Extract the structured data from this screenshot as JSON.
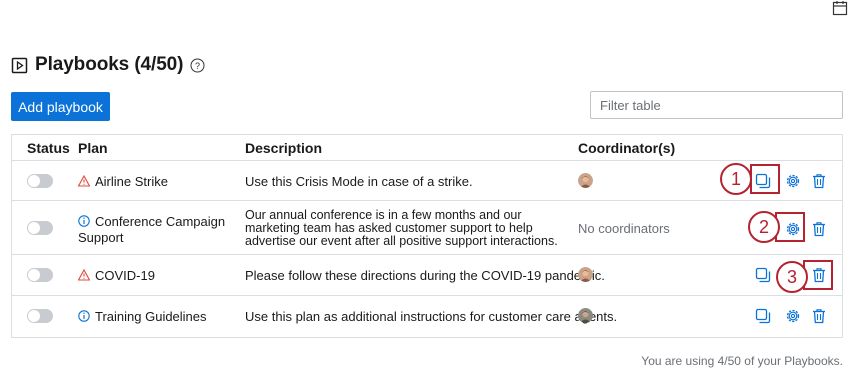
{
  "page": {
    "title": "Playbooks (4/50)",
    "add_button": "Add playbook",
    "filter_placeholder": "Filter table",
    "footer": "You are using 4/50 of your Playbooks."
  },
  "table": {
    "columns": [
      "Status",
      "Plan",
      "Description",
      "Coordinator(s)"
    ],
    "rows": [
      {
        "plan": "Airline Strike",
        "plan_icon": "warning-icon",
        "description": "Use this Crisis Mode in case of a strike.",
        "coordinator": "avatar"
      },
      {
        "plan": "Conference Campaign Support",
        "plan_icon": "info-icon",
        "description": "Our annual conference is in a few months and our marketing team has asked customer support to help advertise our event after all positive support interactions.",
        "coordinator": "No coordinators"
      },
      {
        "plan": "COVID-19",
        "plan_icon": "warning-icon",
        "description": "Please follow these directions during the COVID-19 pandemic.",
        "coordinator": "avatar"
      },
      {
        "plan": "Training Guidelines",
        "plan_icon": "info-icon",
        "description": "Use this plan as additional instructions for customer care agents.",
        "coordinator": "avatar"
      }
    ]
  },
  "callouts": [
    "1",
    "2",
    "3"
  ],
  "colors": {
    "accent": "#0b72d8",
    "warning": "#e0483c",
    "callout": "#b52230"
  }
}
